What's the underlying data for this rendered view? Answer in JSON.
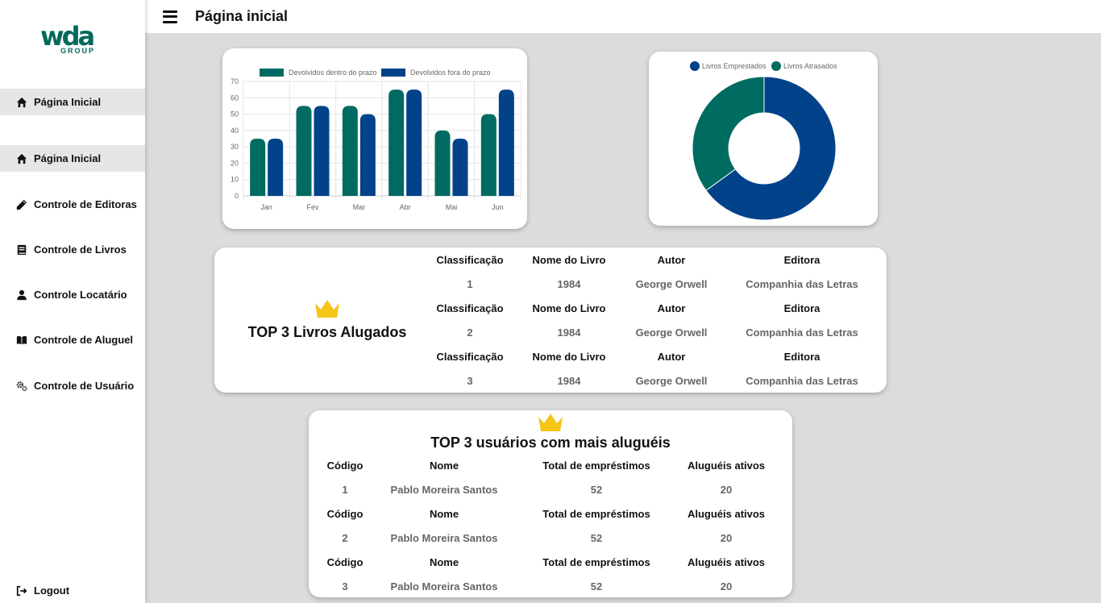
{
  "brand": {
    "logo_main": "wda",
    "logo_sub": "GROUP"
  },
  "header": {
    "title": "Página inicial"
  },
  "sidebar": {
    "items": [
      {
        "label": "Página Inicial",
        "icon": "home-icon"
      },
      {
        "label": "Página Inicial",
        "icon": "home-icon"
      },
      {
        "label": "Controle de Editoras",
        "icon": "pencil-icon"
      },
      {
        "label": "Controle de Livros",
        "icon": "book-icon"
      },
      {
        "label": "Controle Locatário",
        "icon": "user-icon"
      },
      {
        "label": "Controle de Aluguel",
        "icon": "open-book-icon"
      },
      {
        "label": "Controle de Usuário",
        "icon": "gears-icon"
      }
    ],
    "logout": {
      "label": "Logout",
      "icon": "sign-out-icon"
    }
  },
  "colors": {
    "green": "#006b60",
    "blue": "#02428a",
    "crown": "#f5c518"
  },
  "chart_data": [
    {
      "type": "bar",
      "categories": [
        "Jan",
        "Fev",
        "Mar",
        "Abr",
        "Mai",
        "Jun"
      ],
      "series": [
        {
          "name": "Devolvidos dentro do prazo",
          "values": [
            35,
            55,
            55,
            65,
            40,
            50
          ],
          "color": "#006b60"
        },
        {
          "name": "Devolvidos fora do prazo",
          "values": [
            35,
            55,
            50,
            65,
            35,
            65
          ],
          "color": "#02428a"
        }
      ],
      "yticks": [
        0,
        10,
        20,
        30,
        40,
        50,
        60,
        70
      ],
      "ylim": [
        0,
        70
      ],
      "grid": true,
      "legend": "top"
    },
    {
      "type": "pie",
      "variant": "doughnut",
      "labels": [
        "Livros Emprestados",
        "Livros Atrasados"
      ],
      "values": [
        65,
        35
      ],
      "colors": [
        "#02428a",
        "#006b60"
      ],
      "legend": "top"
    }
  ],
  "top_books": {
    "title": "TOP 3 Livros Alugados",
    "headers": [
      "Classificação",
      "Nome do Livro",
      "Autor",
      "Editora"
    ],
    "rows": [
      [
        "1",
        "1984",
        "George Orwell",
        "Companhia das Letras"
      ],
      [
        "2",
        "1984",
        "George Orwell",
        "Companhia das Letras"
      ],
      [
        "3",
        "1984",
        "George Orwell",
        "Companhia das Letras"
      ]
    ]
  },
  "top_users": {
    "title": "TOP 3 usuários com mais aluguéis",
    "headers": [
      "Código",
      "Nome",
      "Total de empréstimos",
      "Aluguéis ativos"
    ],
    "rows": [
      [
        "1",
        "Pablo Moreira Santos",
        "52",
        "20"
      ],
      [
        "2",
        "Pablo Moreira Santos",
        "52",
        "20"
      ],
      [
        "3",
        "Pablo Moreira Santos",
        "52",
        "20"
      ]
    ]
  }
}
